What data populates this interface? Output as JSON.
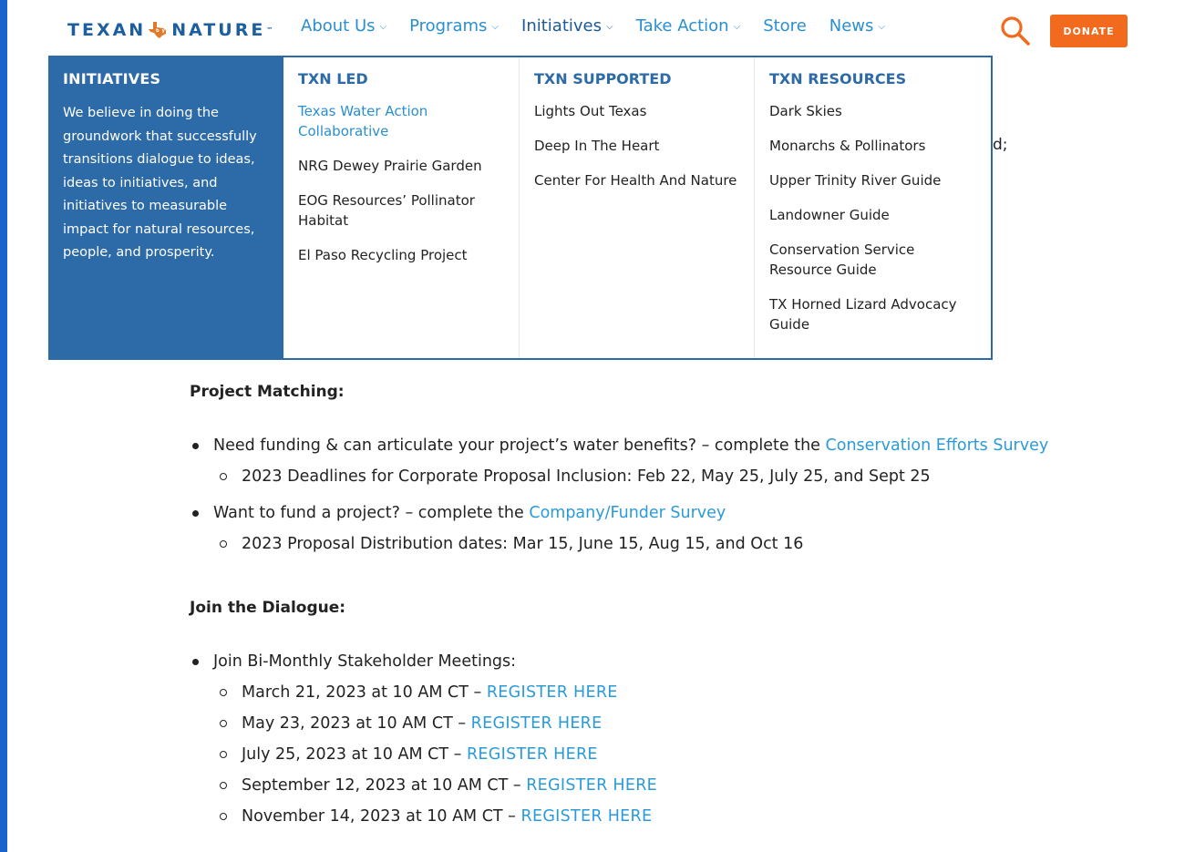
{
  "brand": {
    "logo_left": "TEXAN",
    "logo_mark": "by",
    "logo_right": "NATURE",
    "logo_tm": "™",
    "colors": {
      "primary": "#2d6aa8",
      "link": "#2a9bd8",
      "donate": "#f26a1e",
      "frame": "#1f6fd6"
    }
  },
  "nav": {
    "items": [
      {
        "label": "About Us",
        "has_dropdown": true
      },
      {
        "label": "Programs",
        "has_dropdown": true
      },
      {
        "label": "Initiatives",
        "has_dropdown": true,
        "active": true
      },
      {
        "label": "Take Action",
        "has_dropdown": true
      },
      {
        "label": "Store",
        "has_dropdown": false
      },
      {
        "label": "News",
        "has_dropdown": true
      }
    ],
    "search_icon": "search-icon",
    "donate_label": "DONATE"
  },
  "mega_menu": {
    "intro": {
      "title": "INITIATIVES",
      "text": "We believe in doing the groundwork that successfully transitions dialogue to ideas, ideas to initiatives, and initiatives to measurable impact for natural resources, people, and prosperity."
    },
    "columns": [
      {
        "title": "TXN LED",
        "items": [
          "Texas Water Action Collaborative",
          "NRG Dewey Prairie Garden",
          "EOG Resources’ Pollinator Habitat",
          "El Paso Recycling Project"
        ]
      },
      {
        "title": "TXN SUPPORTED",
        "items": [
          "Lights Out Texas",
          "Deep In The Heart",
          "Center For Health And Nature"
        ]
      },
      {
        "title": "TXN RESOURCES",
        "items": [
          "Dark Skies",
          "Monarchs & Pollinators",
          "Upper Trinity River Guide",
          "Landowner Guide",
          "Conservation Service Resource Guide",
          "TX Horned Lizard Advocacy Guide"
        ]
      }
    ],
    "peek_text": "d;"
  },
  "content": {
    "project_matching": {
      "title": "Project Matching:",
      "bullet1_text": "Need funding & can articulate your project’s water benefits? – complete the ",
      "bullet1_link": "Conservation Efforts Survey",
      "bullet1_sub": "2023 Deadlines for Corporate Proposal Inclusion: Feb 22, May 25, July 25, and Sept 25",
      "bullet2_text": "Want to fund a project? – complete the ",
      "bullet2_link": "Company/Funder Survey",
      "bullet2_sub": "2023 Proposal Distribution dates: Mar 15, June 15, Aug 15, and Oct 16"
    },
    "join_dialogue": {
      "title": "Join the Dialogue:",
      "bullet_text": "Join Bi-Monthly Stakeholder Meetings:",
      "meetings": [
        {
          "date": "March 21, 2023 at 10 AM CT –  ",
          "link": "REGISTER HERE"
        },
        {
          "date": "May 23, 2023 at 10 AM CT –  ",
          "link": "REGISTER HERE"
        },
        {
          "date": "July 25, 2023 at 10 AM CT  –  ",
          "link": "REGISTER HERE"
        },
        {
          "date": "September 12, 2023 at 10 AM CT – ",
          "link": "REGISTER HERE"
        },
        {
          "date": "November 14, 2023 at 10 AM CT – ",
          "link": "REGISTER HERE"
        }
      ]
    }
  }
}
